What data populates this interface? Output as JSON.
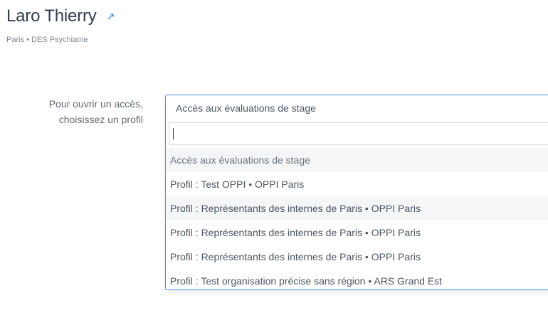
{
  "header": {
    "name": "Laro Thierry",
    "subtitle": "Paris • DES Psychiatrie"
  },
  "form": {
    "label_line1": "Pour ouvrir un accès,",
    "label_line2": "choisissez un profil",
    "selected_value": "Accès aux évaluations de stage",
    "search_value": "",
    "options": [
      {
        "label": "Accès aux évaluations de stage"
      },
      {
        "label": "Profil : Test OPPI • OPPI Paris"
      },
      {
        "label": "Profil : Représentants des internes de Paris • OPPI Paris"
      },
      {
        "label": "Profil : Représentants des internes de Paris • OPPI Paris"
      },
      {
        "label": "Profil : Représentants des internes de Paris • OPPI Paris"
      },
      {
        "label": "Profil : Test organisation précise sans région • ARS Grand Est"
      }
    ]
  },
  "colors": {
    "accent": "#4a90e2",
    "title": "#2e3d4f",
    "muted": "#7b8794",
    "highlight_row": "#f4f6f8"
  },
  "icons": {
    "external_link": "external-link-icon"
  }
}
